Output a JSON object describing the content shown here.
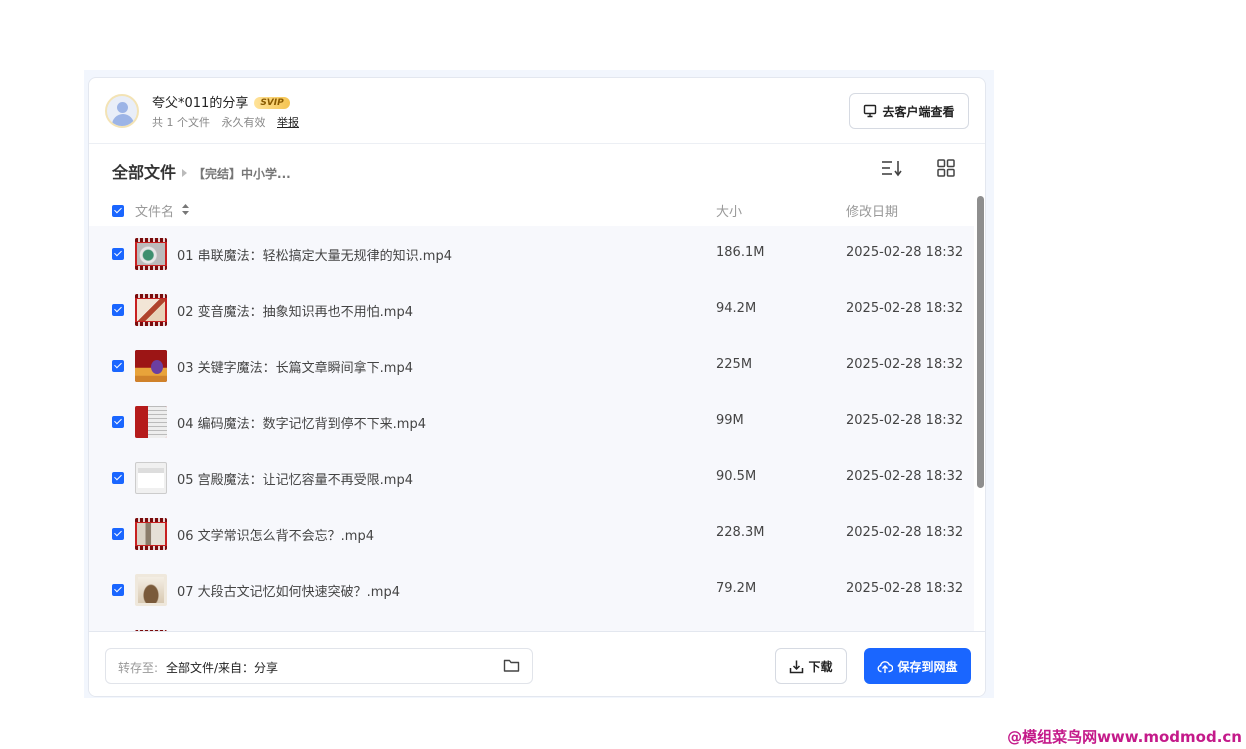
{
  "share": {
    "title": "夸父*011的分享",
    "badge": "SVIP",
    "file_count": "共 1 个文件",
    "validity": "永久有效",
    "report": "举报",
    "client_button": "去客户端查看"
  },
  "breadcrumb": {
    "root": "全部文件",
    "current": "【完结】中小学..."
  },
  "columns": {
    "name": "文件名",
    "size": "大小",
    "date": "修改日期"
  },
  "files": [
    {
      "name": "01 串联魔法：轻松搞定大量无规律的知识.mp4",
      "size": "186.1M",
      "date": "2025-02-28 18:32"
    },
    {
      "name": "02 变音魔法：抽象知识再也不用怕.mp4",
      "size": "94.2M",
      "date": "2025-02-28 18:32"
    },
    {
      "name": "03 关键字魔法：长篇文章瞬间拿下.mp4",
      "size": "225M",
      "date": "2025-02-28 18:32"
    },
    {
      "name": "04 编码魔法：数字记忆背到停不下来.mp4",
      "size": "99M",
      "date": "2025-02-28 18:32"
    },
    {
      "name": "05 宫殿魔法：让记忆容量不再受限.mp4",
      "size": "90.5M",
      "date": "2025-02-28 18:32"
    },
    {
      "name": "06 文学常识怎么背不会忘？.mp4",
      "size": "228.3M",
      "date": "2025-02-28 18:32"
    },
    {
      "name": "07 大段古文记忆如何快速突破？.mp4",
      "size": "79.2M",
      "date": "2025-02-28 18:32"
    }
  ],
  "footer": {
    "save_label": "转存至:",
    "save_path": "全部文件/来自：分享",
    "download": "下载",
    "save_button": "保存到网盘"
  },
  "watermark": "@模组菜鸟网www.modmod.cn",
  "colors": {
    "accent": "#1a66ff",
    "row_bg": "#f7f8fc"
  }
}
